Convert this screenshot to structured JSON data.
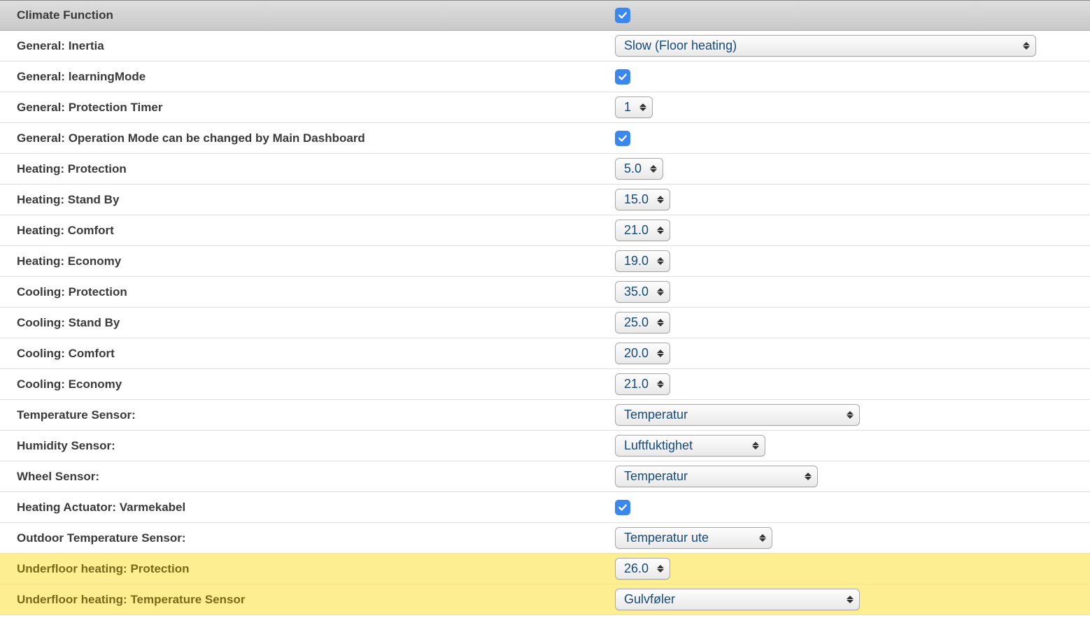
{
  "rows": [
    {
      "id": "climate-function",
      "label": "Climate Function",
      "type": "checkbox",
      "checked": true,
      "header": true
    },
    {
      "id": "general-inertia",
      "label": "General: Inertia",
      "type": "select",
      "value": "Slow (Floor heating)",
      "width": "w-full"
    },
    {
      "id": "general-learningmode",
      "label": "General: learningMode",
      "type": "checkbox",
      "checked": true
    },
    {
      "id": "general-protection-timer",
      "label": "General: Protection Timer",
      "type": "select",
      "value": "1",
      "width": "w-tiny"
    },
    {
      "id": "general-opmode-main",
      "label": "General: Operation Mode can be changed by Main Dashboard",
      "type": "checkbox",
      "checked": true
    },
    {
      "id": "heating-protection",
      "label": "Heating: Protection",
      "type": "select",
      "value": "5.0",
      "width": "w-num"
    },
    {
      "id": "heating-standby",
      "label": "Heating: Stand By",
      "type": "select",
      "value": "15.0",
      "width": "w-num"
    },
    {
      "id": "heating-comfort",
      "label": "Heating: Comfort",
      "type": "select",
      "value": "21.0",
      "width": "w-num"
    },
    {
      "id": "heating-economy",
      "label": "Heating: Economy",
      "type": "select",
      "value": "19.0",
      "width": "w-num"
    },
    {
      "id": "cooling-protection",
      "label": "Cooling: Protection",
      "type": "select",
      "value": "35.0",
      "width": "w-num"
    },
    {
      "id": "cooling-standby",
      "label": "Cooling: Stand By",
      "type": "select",
      "value": "25.0",
      "width": "w-num"
    },
    {
      "id": "cooling-comfort",
      "label": "Cooling: Comfort",
      "type": "select",
      "value": "20.0",
      "width": "w-num"
    },
    {
      "id": "cooling-economy",
      "label": "Cooling: Economy",
      "type": "select",
      "value": "21.0",
      "width": "w-num"
    },
    {
      "id": "temperature-sensor",
      "label": "Temperature Sensor:",
      "type": "select",
      "value": "Temperatur",
      "width": "w-med"
    },
    {
      "id": "humidity-sensor",
      "label": "Humidity Sensor:",
      "type": "select",
      "value": "Luftfuktighet",
      "width": "w-sm"
    },
    {
      "id": "wheel-sensor",
      "label": "Wheel Sensor:",
      "type": "select",
      "value": "Temperatur",
      "width": "w-ms"
    },
    {
      "id": "heating-actuator-varmekabel",
      "label": "Heating Actuator: Varmekabel",
      "type": "checkbox",
      "checked": true
    },
    {
      "id": "outdoor-temperature-sensor",
      "label": "Outdoor Temperature Sensor:",
      "type": "select",
      "value": "Temperatur ute",
      "width": "w-out"
    },
    {
      "id": "underfloor-protection",
      "label": "Underfloor heating: Protection",
      "type": "select",
      "value": "26.0",
      "width": "w-num",
      "highlight": true
    },
    {
      "id": "underfloor-temp-sensor",
      "label": "Underfloor heating: Temperature Sensor",
      "type": "select",
      "value": "Gulvføler",
      "width": "w-med",
      "highlight": true
    }
  ]
}
